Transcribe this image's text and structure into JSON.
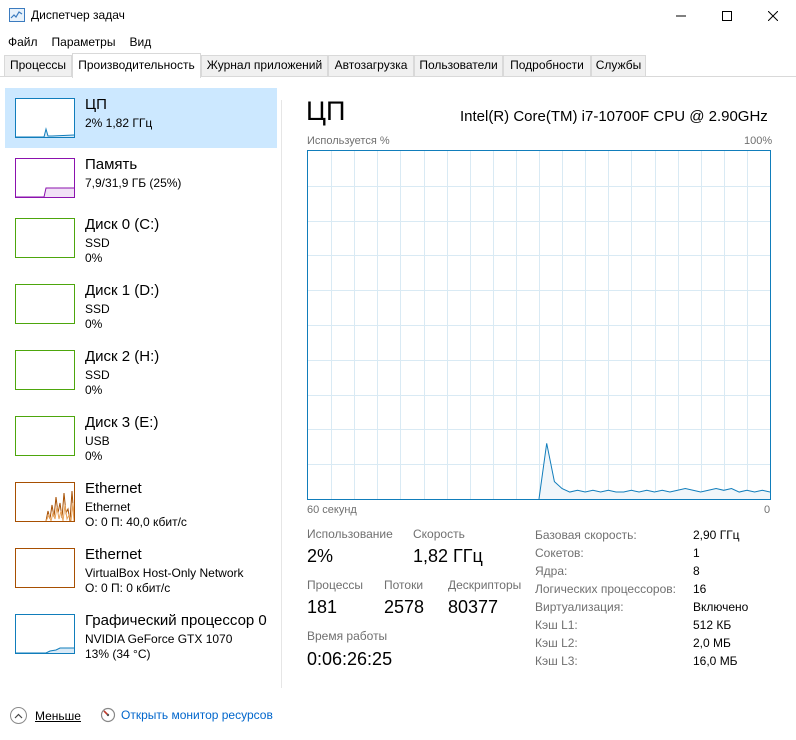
{
  "window": {
    "title": "Диспетчер задач"
  },
  "menu": [
    "Файл",
    "Параметры",
    "Вид"
  ],
  "tabs": [
    {
      "label": "Процессы",
      "active": false
    },
    {
      "label": "Производительность",
      "active": true
    },
    {
      "label": "Журнал приложений",
      "active": false
    },
    {
      "label": "Автозагрузка",
      "active": false
    },
    {
      "label": "Пользователи",
      "active": false
    },
    {
      "label": "Подробности",
      "active": false
    },
    {
      "label": "Службы",
      "active": false
    }
  ],
  "resources": [
    {
      "title": "ЦП",
      "line1": "2% 1,82 ГГц",
      "line2": "",
      "color": "#117dbb",
      "selected": true
    },
    {
      "title": "Память",
      "line1": "7,9/31,9 ГБ (25%)",
      "line2": "",
      "color": "#8b12ae",
      "selected": false
    },
    {
      "title": "Диск 0 (C:)",
      "line1": "SSD",
      "line2": "0%",
      "color": "#4da60c",
      "selected": false
    },
    {
      "title": "Диск 1 (D:)",
      "line1": "SSD",
      "line2": "0%",
      "color": "#4da60c",
      "selected": false
    },
    {
      "title": "Диск 2 (H:)",
      "line1": "SSD",
      "line2": "0%",
      "color": "#4da60c",
      "selected": false
    },
    {
      "title": "Диск 3 (E:)",
      "line1": "USB",
      "line2": "0%",
      "color": "#4da60c",
      "selected": false
    },
    {
      "title": "Ethernet",
      "line1": "Ethernet",
      "line2": "О: 0 П: 40,0 кбит/с",
      "color": "#a74f01",
      "selected": false
    },
    {
      "title": "Ethernet",
      "line1": "VirtualBox Host-Only Network",
      "line2": "О: 0 П: 0 кбит/с",
      "color": "#a74f01",
      "selected": false
    },
    {
      "title": "Графический процессор 0",
      "line1": "NVIDIA GeForce GTX 1070",
      "line2": "13% (34 °C)",
      "color": "#117dbb",
      "selected": false
    }
  ],
  "cpu": {
    "title": "ЦП",
    "model": "Intel(R) Core(TM) i7-10700F CPU @ 2.90GHz",
    "graph_label_left": "Используется %",
    "graph_label_right": "100%",
    "axis_left": "60 секунд",
    "axis_right": "0",
    "usage_label": "Использование",
    "usage_value": "2%",
    "speed_label": "Скорость",
    "speed_value": "1,82 ГГц",
    "processes_label": "Процессы",
    "processes_value": "181",
    "threads_label": "Потоки",
    "threads_value": "2578",
    "handles_label": "Дескрипторы",
    "handles_value": "80377",
    "uptime_label": "Время работы",
    "uptime_value": "0:06:26:25",
    "details": [
      {
        "label": "Базовая скорость:",
        "value": "2,90 ГГц"
      },
      {
        "label": "Сокетов:",
        "value": "1"
      },
      {
        "label": "Ядра:",
        "value": "8"
      },
      {
        "label": "Логических процессоров:",
        "value": "16"
      },
      {
        "label": "Виртуализация:",
        "value": "Включено"
      },
      {
        "label": "Кэш L1:",
        "value": "512 КБ"
      },
      {
        "label": "Кэш L2:",
        "value": "2,0 МБ"
      },
      {
        "label": "Кэш L3:",
        "value": "16,0 МБ"
      }
    ]
  },
  "chart_data": {
    "type": "area",
    "ylabel": "Используется %",
    "ylim": [
      0,
      100
    ],
    "x": [
      30,
      29,
      28,
      27,
      26,
      25,
      24,
      23,
      22,
      21,
      20,
      19,
      18,
      17,
      16,
      15,
      14,
      13,
      12,
      11,
      10,
      9,
      8,
      7,
      6,
      5,
      4,
      3,
      2,
      1,
      0
    ],
    "values": [
      0,
      16,
      5,
      3,
      2,
      2.5,
      2,
      2.5,
      2,
      2.5,
      2,
      2,
      2.5,
      2,
      2.5,
      2,
      2.5,
      2,
      2.5,
      3,
      2.5,
      2,
      2.5,
      3,
      2.5,
      3,
      2,
      2.5,
      2,
      2.5,
      2
    ],
    "grid": true
  },
  "footer": {
    "less_label": "Меньше",
    "monitor_label": "Открыть монитор ресурсов"
  },
  "icons": {
    "app": "task-manager-icon",
    "less": "chevron-up-icon",
    "monitor": "resource-monitor-icon"
  }
}
